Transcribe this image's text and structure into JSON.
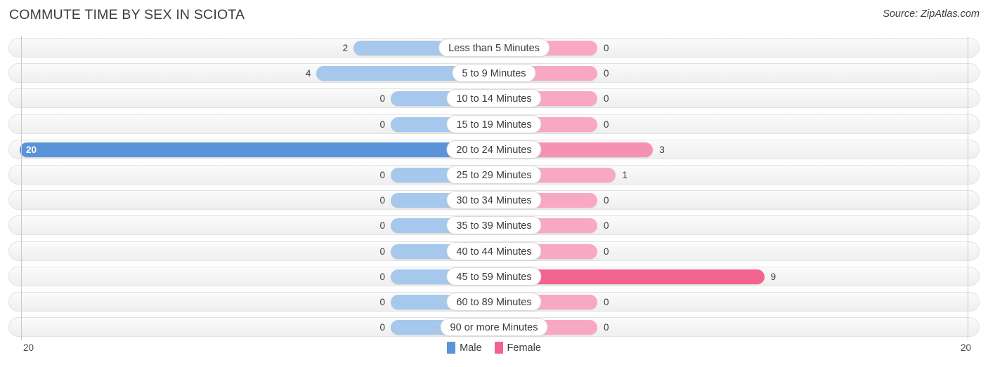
{
  "header": {
    "title": "COMMUTE TIME BY SEX IN SCIOTA",
    "source": "Source: ZipAtlas.com"
  },
  "legend": {
    "male_label": "Male",
    "female_label": "Female",
    "male_color": "#5b93d8",
    "female_color": "#f2638f"
  },
  "axis": {
    "left_tick": "20",
    "right_tick": "20",
    "max": 20
  },
  "colors": {
    "male_light": "#a6c8ec",
    "male_strong": "#5b93d8",
    "female_light": "#f9a8c4",
    "female_mid": "#f791b4",
    "female_strong": "#f2638f",
    "track": "#f4f4f4",
    "text": "#3c3c3c"
  },
  "chart_data": {
    "type": "bar",
    "orientation": "horizontal",
    "layout": "diverging-pyramid",
    "title": "COMMUTE TIME BY SEX IN SCIOTA",
    "xlabel": "",
    "ylabel": "",
    "xlim": [
      20,
      20
    ],
    "grid": false,
    "legend_position": "bottom-center",
    "categories": [
      "Less than 5 Minutes",
      "5 to 9 Minutes",
      "10 to 14 Minutes",
      "15 to 19 Minutes",
      "20 to 24 Minutes",
      "25 to 29 Minutes",
      "30 to 34 Minutes",
      "35 to 39 Minutes",
      "40 to 44 Minutes",
      "45 to 59 Minutes",
      "60 to 89 Minutes",
      "90 or more Minutes"
    ],
    "series": [
      {
        "name": "Male",
        "side": "left",
        "values": [
          2,
          4,
          0,
          0,
          20,
          0,
          0,
          0,
          0,
          0,
          0,
          0
        ]
      },
      {
        "name": "Female",
        "side": "right",
        "values": [
          0,
          0,
          0,
          0,
          3,
          1,
          0,
          0,
          0,
          9,
          0,
          0
        ]
      }
    ]
  },
  "rows": [
    {
      "label": "Less than 5 Minutes",
      "male": "2",
      "female": "0"
    },
    {
      "label": "5 to 9 Minutes",
      "male": "4",
      "female": "0"
    },
    {
      "label": "10 to 14 Minutes",
      "male": "0",
      "female": "0"
    },
    {
      "label": "15 to 19 Minutes",
      "male": "0",
      "female": "0"
    },
    {
      "label": "20 to 24 Minutes",
      "male": "20",
      "female": "3"
    },
    {
      "label": "25 to 29 Minutes",
      "male": "0",
      "female": "1"
    },
    {
      "label": "30 to 34 Minutes",
      "male": "0",
      "female": "0"
    },
    {
      "label": "35 to 39 Minutes",
      "male": "0",
      "female": "0"
    },
    {
      "label": "40 to 44 Minutes",
      "male": "0",
      "female": "0"
    },
    {
      "label": "45 to 59 Minutes",
      "male": "0",
      "female": "9"
    },
    {
      "label": "60 to 89 Minutes",
      "male": "0",
      "female": "0"
    },
    {
      "label": "90 or more Minutes",
      "male": "0",
      "female": "0"
    }
  ]
}
